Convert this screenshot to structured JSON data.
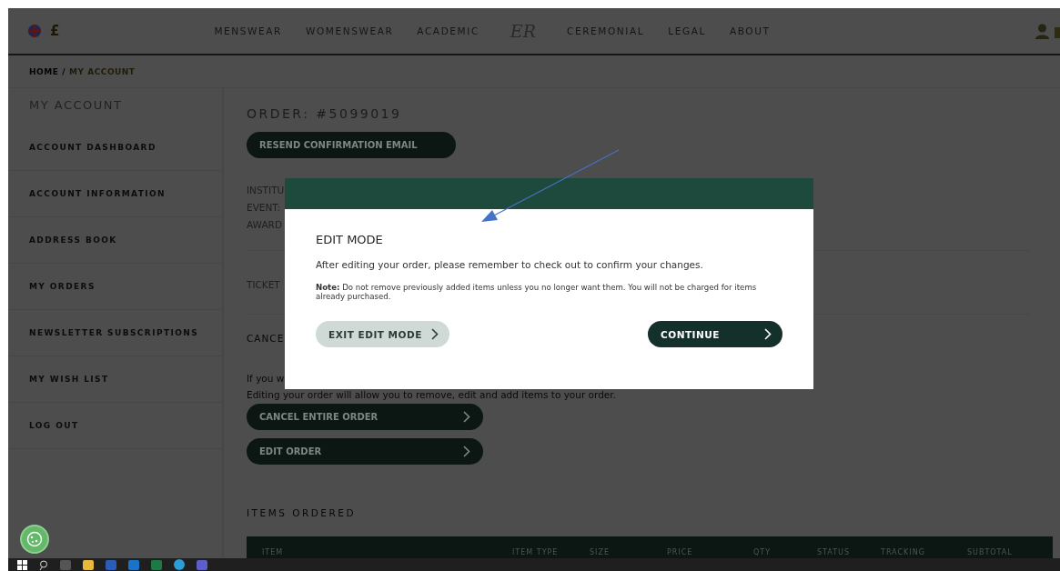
{
  "header": {
    "currency": "£",
    "nav_left": [
      "MENSWEAR",
      "WOMENSWEAR",
      "ACADEMIC"
    ],
    "logo": "ER",
    "nav_right": [
      "CEREMONIAL",
      "LEGAL",
      "ABOUT"
    ]
  },
  "breadcrumb": [
    {
      "label": "HOME",
      "selected": false
    },
    {
      "label": "/",
      "selected": false
    },
    {
      "label": "MY ACCOUNT",
      "selected": true
    }
  ],
  "sidebar": {
    "title": "MY ACCOUNT",
    "items": [
      "ACCOUNT DASHBOARD",
      "ACCOUNT INFORMATION",
      "ADDRESS BOOK",
      "MY ORDERS",
      "NEWSLETTER SUBSCRIPTIONS",
      "MY WISH LIST",
      "LOG OUT"
    ]
  },
  "order": {
    "title": "ORDER: #5099019",
    "resend_button": "RESEND CONFIRMATION EMAIL",
    "details": [
      "INSTITU",
      "EVENT:",
      "AWARD"
    ],
    "ticket": "TICKET",
    "cancel_heading": "CANCE",
    "info": [
      "If you w",
      "Editing your order will allow you to remove, edit and add items to your order."
    ],
    "actions": [
      "CANCEL ENTIRE ORDER",
      "EDIT ORDER"
    ],
    "items_heading": "ITEMS ORDERED",
    "table": {
      "columns": [
        "ITEM",
        "ITEM TYPE",
        "SIZE",
        "PRICE",
        "QTY",
        "STATUS",
        "TRACKING",
        "SUBTOTAL"
      ]
    }
  },
  "modal": {
    "title": "EDIT MODE",
    "message": "After editing your order, please remember to check out to confirm your changes.",
    "note": "**Note:** Do not remove previously added items unless you no longer want them. You will not be charged for items already purchased.",
    "buttons": [
      {
        "label": "EXIT EDIT MODE",
        "kind": "secondary"
      },
      {
        "label": "CONTINUE",
        "kind": "primary"
      }
    ]
  }
}
